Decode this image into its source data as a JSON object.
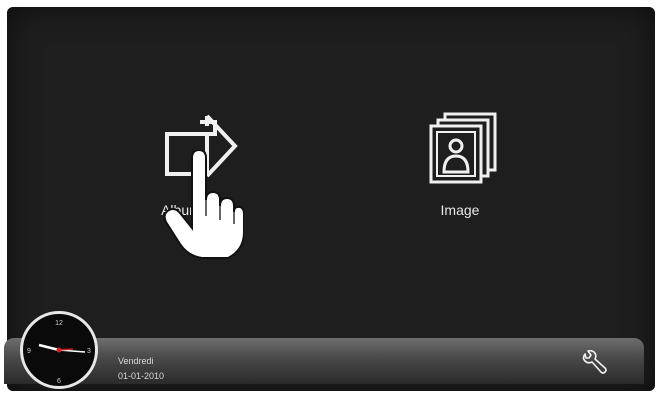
{
  "tiles": {
    "audio": {
      "label": "Album audio",
      "icon": "audio-album-icon"
    },
    "image": {
      "label": "Image",
      "icon": "image-gallery-icon"
    }
  },
  "clock": {
    "numerals": [
      "12",
      "3",
      "6",
      "9"
    ],
    "icon": "analog-clock-icon"
  },
  "status_bar": {
    "day": "Vendredi",
    "date": "01-01-2010",
    "settings_icon": "wrench-icon"
  },
  "colors": {
    "background": "#1e1e1e",
    "bar": "#4b4b4b",
    "text": "#e6e6e6"
  }
}
